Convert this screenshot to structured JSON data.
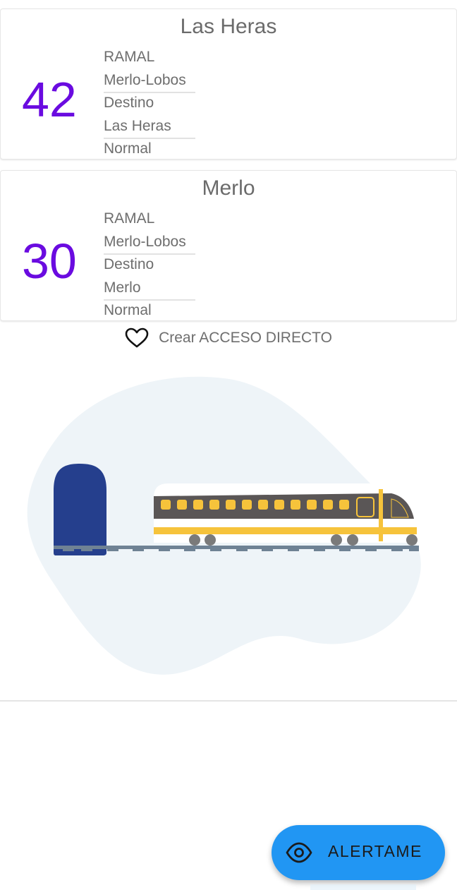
{
  "cards": [
    {
      "title": "Las Heras",
      "number": "42",
      "ramal_label": "RAMAL",
      "ramal_value": "Merlo-Lobos",
      "destino_label": "Destino",
      "destino_value": "Las Heras",
      "status": "Normal"
    },
    {
      "title": "Merlo",
      "number": "30",
      "ramal_label": "RAMAL",
      "ramal_value": "Merlo-Lobos",
      "destino_label": "Destino",
      "destino_value": "Merlo",
      "status": "Normal"
    }
  ],
  "shortcut": {
    "icon": "heart-outline-icon",
    "label": "Crear ACCESO DIRECTO"
  },
  "fab": {
    "icon": "eye-icon",
    "label": "ALERTAME"
  },
  "colors": {
    "number": "#6a0be0",
    "fab": "#2196f3",
    "train_stripe": "#f6c33b",
    "tunnel": "#253f8d",
    "blob": "#eef4f8"
  }
}
